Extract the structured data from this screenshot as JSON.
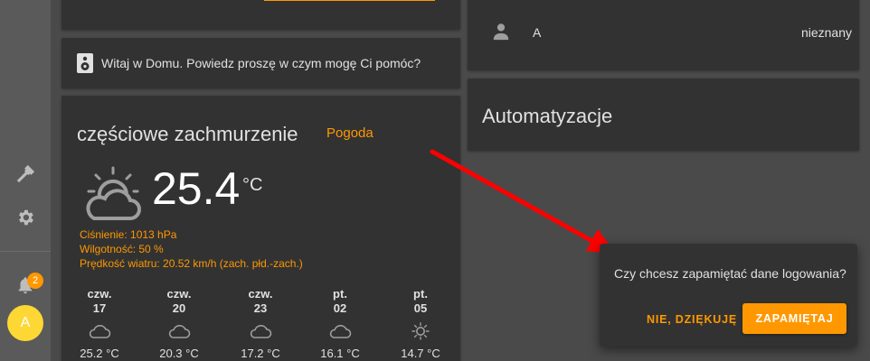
{
  "sidebar": {
    "notifications_count": "2",
    "user_initial": "A",
    "icons": [
      "hammer-icon",
      "gear-icon",
      "bell-icon"
    ]
  },
  "conversation": {
    "text": "Witaj w Domu. Powiedz proszę w czym mogę Ci pomóc?"
  },
  "weather": {
    "condition": "częściowe zachmurzenie",
    "name": "Pogoda",
    "temperature": "25.4",
    "unit": "°C",
    "attributes": [
      "Ciśnienie: 1013 hPa",
      "Wilgotność: 50 %",
      "Prędkość wiatru: 20.52 km/h (zach. płd.-zach.)"
    ],
    "forecast": [
      {
        "day": "czw.",
        "date": "17",
        "temp": "25.2 °C",
        "icon": "cloud-icon"
      },
      {
        "day": "czw.",
        "date": "20",
        "temp": "20.3 °C",
        "icon": "cloud-icon"
      },
      {
        "day": "czw.",
        "date": "23",
        "temp": "17.2 °C",
        "icon": "cloud-icon"
      },
      {
        "day": "pt.",
        "date": "02",
        "temp": "16.1 °C",
        "icon": "cloud-icon"
      },
      {
        "day": "pt.",
        "date": "05",
        "temp": "14.7 °C",
        "icon": "sun-icon"
      }
    ]
  },
  "user_entity": {
    "name": "A",
    "state": "nieznany"
  },
  "automations": {
    "title": "Automatyzacje"
  },
  "dialog": {
    "question": "Czy chcesz zapamiętać dane logowania?",
    "decline_label": "NIE, DZIĘKUJĘ",
    "accept_label": "ZAPAMIĘTAJ"
  },
  "colors": {
    "accent": "#ff9800",
    "card": "#323232",
    "background": "#4a4a4a",
    "arrow": "#ff0000"
  }
}
